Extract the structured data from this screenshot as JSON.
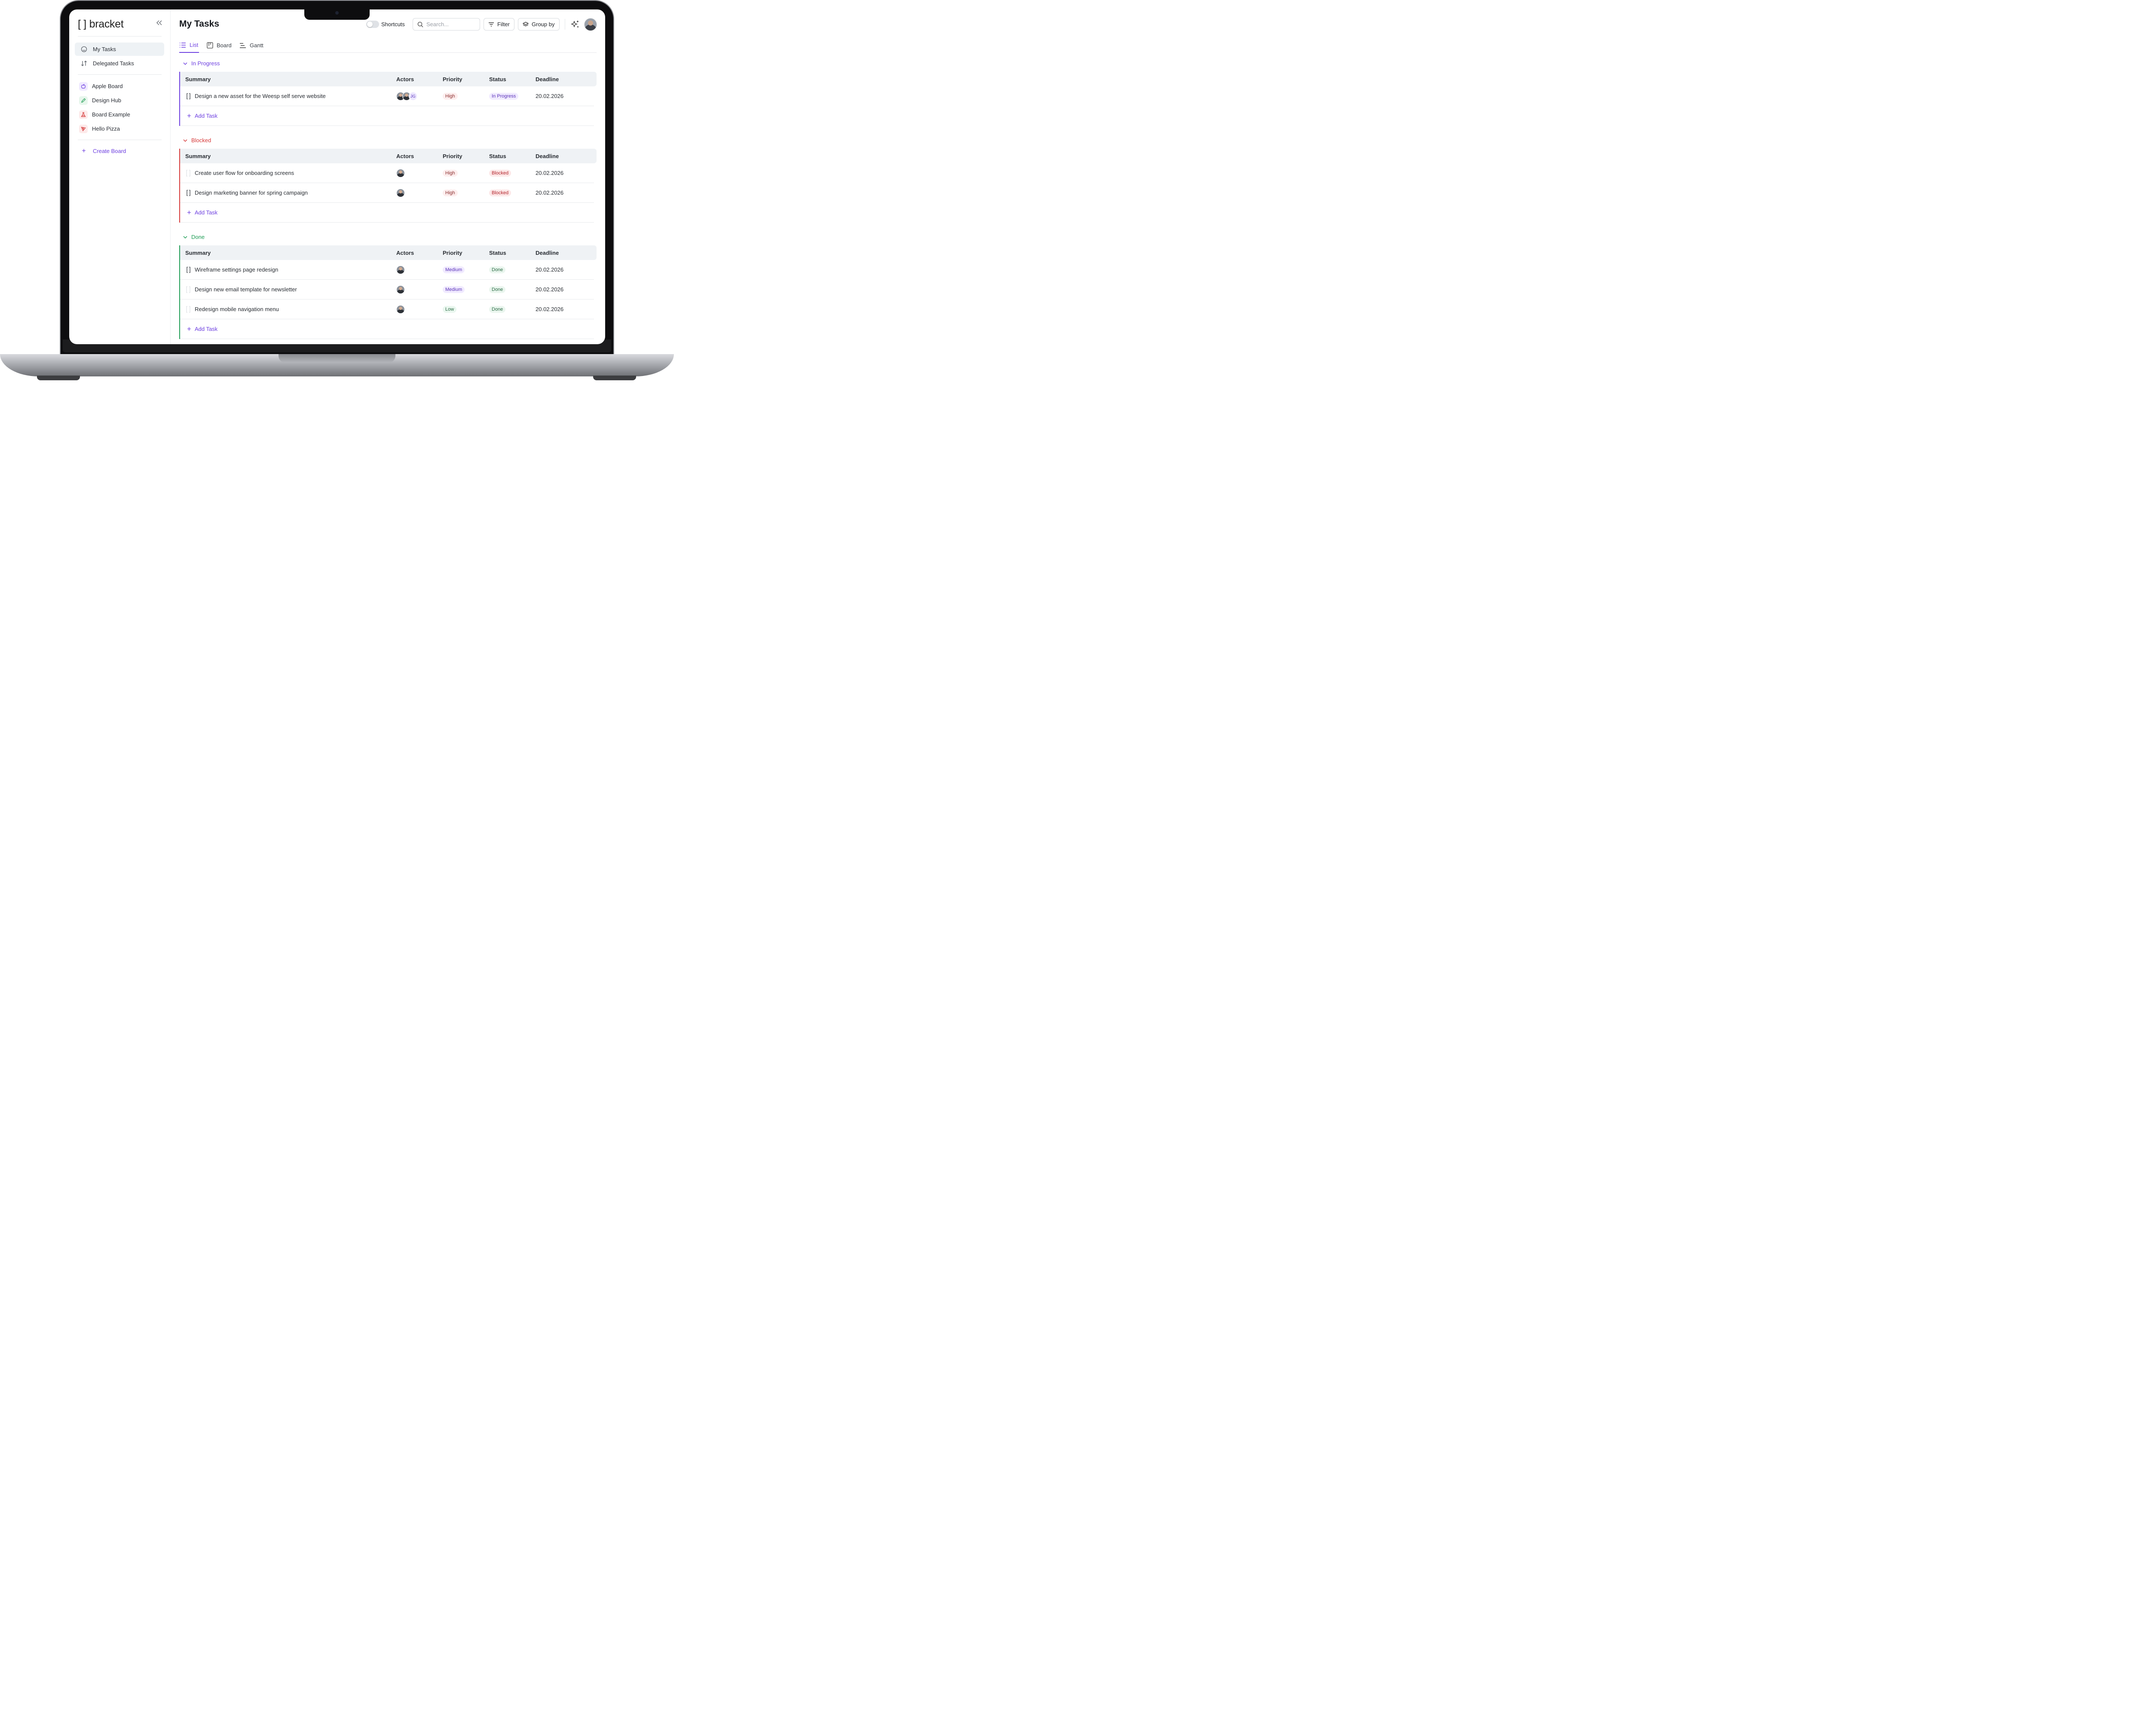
{
  "app": {
    "logo_bracket": "[ ]",
    "logo_text": "bracket"
  },
  "sidebar": {
    "nav": [
      {
        "label": "My Tasks",
        "icon": "home-icon",
        "active": true
      },
      {
        "label": "Delegated Tasks",
        "icon": "sort-arrows-icon",
        "active": false
      }
    ],
    "boards": [
      {
        "label": "Apple Board",
        "icon": "apple-icon",
        "color": "#6d3fe0",
        "bg": "#efe9ff"
      },
      {
        "label": "Design Hub",
        "icon": "pen-icon",
        "color": "#1f9d55",
        "bg": "#e7f6ec"
      },
      {
        "label": "Board Example",
        "icon": "flask-icon",
        "color": "#d63a3a",
        "bg": "#fdeaea"
      },
      {
        "label": "Hello Pizza",
        "icon": "pizza-icon",
        "color": "#d63a3a",
        "bg": "#fdeaea"
      }
    ],
    "create_label": "Create Board"
  },
  "header": {
    "title": "My Tasks",
    "shortcuts_label": "Shortcuts",
    "shortcuts_on": false,
    "search_placeholder": "Search...",
    "filter_label": "Filter",
    "group_label": "Group by"
  },
  "tabs": [
    {
      "label": "List",
      "active": true
    },
    {
      "label": "Board",
      "active": false
    },
    {
      "label": "Gantt",
      "active": false
    }
  ],
  "columns": {
    "summary": "Summary",
    "actors": "Actors",
    "priority": "Priority",
    "status": "Status",
    "deadline": "Deadline"
  },
  "add_task_label": "Add Task",
  "groups": [
    {
      "name": "In Progress",
      "color": "#6d3fe0",
      "tasks": [
        {
          "summary": "Design a new asset for the Weesp self serve website",
          "bracket": true,
          "actors": 2,
          "extra_actor": "JG",
          "priority": "High",
          "status": "In Progress",
          "deadline": "20.02.2026"
        }
      ]
    },
    {
      "name": "Blocked",
      "color": "#d63a3a",
      "tasks": [
        {
          "summary": "Create user flow for onboarding screens",
          "bracket": false,
          "actors": 1,
          "extra_actor": "",
          "priority": "High",
          "status": "Blocked",
          "deadline": "20.02.2026"
        },
        {
          "summary": "Design marketing banner for spring campaign",
          "bracket": true,
          "actors": 1,
          "extra_actor": "",
          "priority": "High",
          "status": "Blocked",
          "deadline": "20.02.2026"
        }
      ]
    },
    {
      "name": "Done",
      "color": "#1f9d55",
      "tasks": [
        {
          "summary": "Wireframe settings page redesign",
          "bracket": true,
          "actors": 1,
          "extra_actor": "",
          "priority": "Medium",
          "status": "Done",
          "deadline": "20.02.2026"
        },
        {
          "summary": "Design new email template for newsletter",
          "bracket": false,
          "actors": 1,
          "extra_actor": "",
          "priority": "Medium",
          "status": "Done",
          "deadline": "20.02.2026"
        },
        {
          "summary": "Redesign mobile navigation menu",
          "bracket": false,
          "actors": 1,
          "extra_actor": "",
          "priority": "Low",
          "status": "Done",
          "deadline": "20.02.2026"
        }
      ]
    }
  ]
}
